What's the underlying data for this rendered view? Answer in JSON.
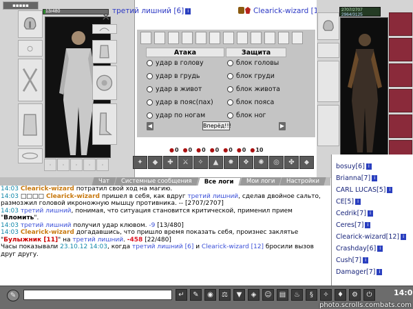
{
  "left_fighter": {
    "name": "третий лишний",
    "level": "[6]",
    "hp_text": "13/480",
    "hp_fraction": 0.027
  },
  "right_fighter": {
    "name": "Clearick-wizard",
    "level": "[12]",
    "hp_text": "2707/2707",
    "mana_text": "2964/3125",
    "hp_fraction": 1.0
  },
  "fight": {
    "attack_title": "Атака",
    "defense_title": "Защита",
    "attack_options": [
      "удар в голову",
      "удар в грудь",
      "удар в живот",
      "удар в пояс(пах)",
      "удар по ногам"
    ],
    "defense_options": [
      "блок головы",
      "блок груди",
      "блок живота",
      "блок пояса",
      "блок ног"
    ],
    "go_button": "Вперёд!!!",
    "stats": [
      "0",
      "0",
      "0",
      "0",
      "0",
      "0",
      "10"
    ]
  },
  "tabs": [
    "Чат",
    "Системные сообщения",
    "Все логи",
    "Мои логи",
    "Настройки"
  ],
  "active_tab": "Все логи",
  "log": [
    {
      "time": "14:03",
      "parts": [
        {
          "t": "Clearick-wizard",
          "c": "me"
        },
        {
          "t": " потратил свой ход на магию.",
          "c": ""
        }
      ]
    },
    {
      "time": "14:03",
      "parts": [
        {
          "t": "□□□□",
          "c": ""
        },
        {
          "t": " Clearick-wizard",
          "c": "me"
        },
        {
          "t": " пришел в себя, как вдруг ",
          "c": ""
        },
        {
          "t": "третий лишний",
          "c": "enemy"
        },
        {
          "t": ", сделав двойное сальто, размозжил головой икроножную мышцу противника. -- [2707/2707]",
          "c": ""
        }
      ]
    },
    {
      "time": "14:03",
      "parts": [
        {
          "t": "третий лишний",
          "c": "enemy"
        },
        {
          "t": ", понимая, что ситуация становится критической, применил прием \"",
          "c": ""
        },
        {
          "t": "Вломить",
          "c": "b"
        },
        {
          "t": "\".",
          "c": ""
        }
      ]
    },
    {
      "time": "14:03",
      "parts": [
        {
          "t": "третий лишний",
          "c": "enemy"
        },
        {
          "t": " получил удар клювом. ",
          "c": ""
        },
        {
          "t": "-9",
          "c": "enemy"
        },
        {
          "t": " [13/480]",
          "c": ""
        }
      ]
    },
    {
      "time": "14:03",
      "parts": [
        {
          "t": "Clearick-wizard",
          "c": "me"
        },
        {
          "t": " догадавшись, что пришло время показать себя, произнес заклятье \"",
          "c": ""
        },
        {
          "t": "Булыжник [11]",
          "c": "spell"
        },
        {
          "t": "\" на ",
          "c": ""
        },
        {
          "t": "третий лишний",
          "c": "enemy"
        },
        {
          "t": ". ",
          "c": ""
        },
        {
          "t": "-458",
          "c": "dmg"
        },
        {
          "t": " [22/480]",
          "c": ""
        }
      ]
    },
    {
      "time": "",
      "parts": [
        {
          "t": "Часы показывали ",
          "c": ""
        },
        {
          "t": "23.10.12 14:03",
          "c": "time"
        },
        {
          "t": ", когда ",
          "c": ""
        },
        {
          "t": "третий лишний [6]",
          "c": "enemy"
        },
        {
          "t": " и ",
          "c": ""
        },
        {
          "t": "Clearick-wizard [12]",
          "c": "enemy"
        },
        {
          "t": " бросили вызов друг другу.",
          "c": ""
        }
      ]
    }
  ],
  "online": [
    {
      "name": "bosuy",
      "level": "[6]"
    },
    {
      "name": "Brianna",
      "level": "[7]"
    },
    {
      "name": "CARL LUCAS",
      "level": "[5]"
    },
    {
      "name": "CE",
      "level": "[5]"
    },
    {
      "name": "Cedrik",
      "level": "[7]"
    },
    {
      "name": "Ceres",
      "level": "[7]"
    },
    {
      "name": "Clearick-wizard",
      "level": "[12]"
    },
    {
      "name": "Crashday",
      "level": "[6]"
    },
    {
      "name": "Cush",
      "level": "[7]"
    },
    {
      "name": "Damager",
      "level": "[7]"
    }
  ],
  "clock": "14:0",
  "watermark": "photo.scrolls.combats.com",
  "colors": {
    "me": "#c8790f",
    "enemy": "#3a4fd8",
    "time": "#1188aa"
  }
}
